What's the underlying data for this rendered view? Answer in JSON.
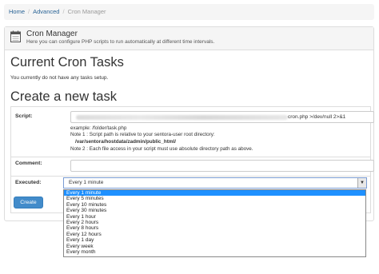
{
  "breadcrumb": {
    "home": "Home",
    "advanced": "Advanced",
    "current": "Cron Manager"
  },
  "module": {
    "title": "Cron Manager",
    "description": "Here you can configure PHP scripts to run automatically at different time intervals.",
    "icon": "calendar-icon"
  },
  "current_tasks": {
    "heading": "Current Cron Tasks",
    "message": "You currently do not have any tasks setup."
  },
  "create": {
    "heading": "Create a new task",
    "script_label": "Script:",
    "script_value_visible_suffix": "cron.php >/dev/null 2>&1",
    "example": "example: /folder/task.php",
    "note1": "Note 1 : Script path is relative to your sentora-user root directory:",
    "note1_path": "/var/sentora/hostdata/zadmin/public_html/",
    "note2": "Note 2 : Each file access in your script must use absolute directory path as above.",
    "comment_label": "Comment:",
    "comment_value": "",
    "executed_label": "Executed:",
    "executed_value": "Every 1 minute",
    "button": "Create"
  },
  "executed_options": [
    "Every 1 minute",
    "Every 5 minutes",
    "Every 10 minutes",
    "Every 30 minutes",
    "Every 1 hour",
    "Every 2 hours",
    "Every 8 hours",
    "Every 12 hours",
    "Every 1 day",
    "Every week",
    "Every month"
  ],
  "selected_option_index": 0,
  "colors": {
    "primary_button": "#428bca",
    "link": "#2a6496",
    "selection": "#1e90ff"
  }
}
